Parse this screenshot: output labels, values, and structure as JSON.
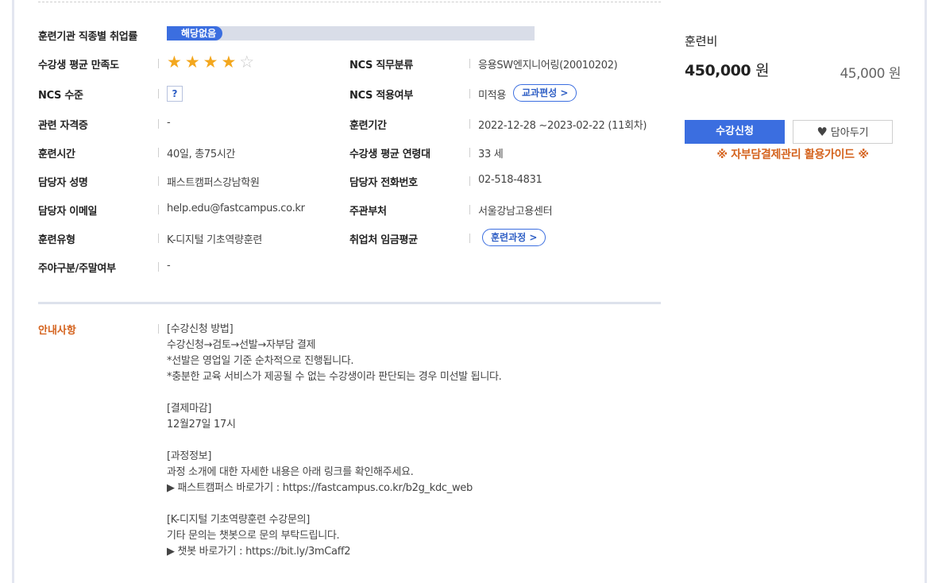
{
  "info": {
    "employment_rate": {
      "label": "훈련기관 직종별 취업률",
      "value": "해당없음"
    },
    "satisfaction": {
      "label": "수강생 평균 만족도",
      "stars": 4,
      "max_stars": 5
    },
    "ncs_category": {
      "label": "NCS 직무분류",
      "value": "응용SW엔지니어링(20010202)"
    },
    "ncs_level": {
      "label": "NCS 수준",
      "value": "?"
    },
    "ncs_applied": {
      "label": "NCS 적용여부",
      "value": "미적용",
      "button": "교과편성 >"
    },
    "certificate": {
      "label": "관련 자격증",
      "value": "-"
    },
    "training_period": {
      "label": "훈련기간",
      "value": "2022-12-28 ~2023-02-22 (11회차)"
    },
    "training_hours": {
      "label": "훈련시간",
      "value": "40일, 총75시간"
    },
    "avg_age": {
      "label": "수강생 평균 연령대",
      "value": "33 세"
    },
    "manager_name": {
      "label": "담당자 성명",
      "value": "패스트캠퍼스강남학원"
    },
    "manager_phone": {
      "label": "담당자 전화번호",
      "value": "02-518-4831"
    },
    "manager_email": {
      "label": "담당자 이메일",
      "value": "help.edu@fastcampus.co.kr"
    },
    "authority": {
      "label": "주관부처",
      "value": "서울강남고용센터"
    },
    "training_type": {
      "label": "훈련유형",
      "value": "K-디지털 기초역량훈련"
    },
    "avg_wage": {
      "label": "취업처 임금평균",
      "button": "훈련과정 >"
    },
    "day_night": {
      "label": "주야구분/주말여부",
      "value": "-"
    }
  },
  "notice": {
    "label": "안내사항",
    "lines": [
      "[수강신청 방법]",
      "수강신청→검토→선발→자부담 결제",
      "*선발은 영업일 기준 순차적으로 진행됩니다.",
      "*충분한 교육 서비스가 제공될 수 없는 수강생이라 판단되는 경우 미선발 됩니다.",
      "",
      "[결제마감]",
      "12월27일 17시",
      "",
      "[과정정보]",
      "과정 소개에 대한 자세한 내용은 아래 링크를 확인해주세요.",
      "▶ 패스트캠퍼스 바로가기 : https://fastcampus.co.kr/b2g_kdc_web",
      "",
      "[K-디지털 기초역량훈련 수강문의]",
      "기타 문의는 챗봇으로 문의 부탁드립니다.",
      "▶ 챗봇 바로가기 : https://bit.ly/3mCaff2"
    ]
  },
  "sidebar": {
    "fee_label": "훈련비",
    "fee_amount": "450,000",
    "fee_unit": "원",
    "self_pay": "45,000 원",
    "apply_button": "수강신청",
    "wish_button": "담아두기",
    "guide_link": "※ 자부담결제관리 활용가이드 ※"
  },
  "colors": {
    "accent": "#3b6ee0",
    "orange": "#d4621d",
    "star": "#f3a71e",
    "track": "#d9dde8"
  }
}
